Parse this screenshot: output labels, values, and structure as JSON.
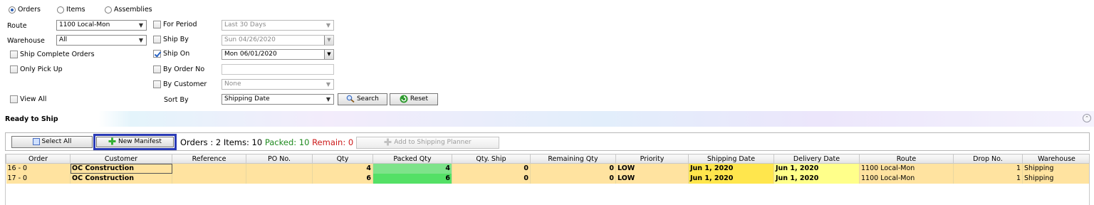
{
  "view_options": [
    {
      "label": "Orders",
      "selected": true
    },
    {
      "label": "Items",
      "selected": false
    },
    {
      "label": "Assemblies",
      "selected": false
    }
  ],
  "filters": {
    "route_label": "Route",
    "route_value": "1100 Local-Mon",
    "warehouse_label": "Warehouse",
    "warehouse_value": "All",
    "ship_complete_label": "Ship Complete Orders",
    "only_pickup_label": "Only Pick Up",
    "view_all_label": "View All",
    "for_period_label": "For Period",
    "for_period_value": "Last 30 Days",
    "ship_by_label": "Ship By",
    "ship_by_value": "Sun 04/26/2020",
    "ship_on_label": "Ship On",
    "ship_on_value": "Mon 06/01/2020",
    "ship_on_checked": true,
    "by_order_label": "By Order No",
    "by_order_value": "",
    "by_customer_label": "By Customer",
    "by_customer_value": "None",
    "sort_by_label": "Sort By",
    "sort_by_value": "Shipping Date",
    "search_label": "Search",
    "reset_label": "Reset"
  },
  "section_title": "Ready to Ship",
  "toolbar": {
    "select_all_label": "Select All",
    "new_manifest_label": "New Manifest",
    "summary_prefix": "Orders : 2 Items: 10 ",
    "packed_text": "Packed: 10",
    "remain_text": "Remain: 0",
    "add_planner_label": "Add to Shipping Planner"
  },
  "colors": {
    "packed": "#1f8a1f",
    "remain": "#cc1a1a",
    "row_bg": "#ffe3a0",
    "packed_cell": "#7ee38a",
    "ship_date_cell": "#ffe64d",
    "delivery_date_cell": "#ffff8a",
    "highlight_border": "#2a3bb5"
  },
  "table": {
    "columns": [
      "Order",
      "Customer",
      "Reference",
      "PO No.",
      "Qty",
      "Packed Qty",
      "Qty. Ship",
      "Remaining Qty",
      "Priority",
      "Shipping Date",
      "Delivery Date",
      "Route",
      "Drop No.",
      "Warehouse"
    ],
    "rows": [
      {
        "order": "16 - 0",
        "customer": "OC Construction",
        "reference": "",
        "po": "",
        "qty": "4",
        "packed": "4",
        "qty_ship": "0",
        "remaining": "0",
        "priority": "LOW",
        "ship_date": "Jun 1, 2020",
        "delivery_date": "Jun 1, 2020",
        "route": "1100 Local-Mon",
        "drop": "1",
        "warehouse": "Shipping"
      },
      {
        "order": "17 - 0",
        "customer": "OC Construction",
        "reference": "",
        "po": "",
        "qty": "6",
        "packed": "6",
        "qty_ship": "0",
        "remaining": "0",
        "priority": "LOW",
        "ship_date": "Jun 1, 2020",
        "delivery_date": "Jun 1, 2020",
        "route": "1100 Local-Mon",
        "drop": "1",
        "warehouse": "Shipping"
      }
    ]
  },
  "icons": {
    "collapse": "double-chevron-up-icon",
    "search": "magnifier-icon",
    "reset": "refresh-icon",
    "new_manifest": "plus-icon",
    "add_planner": "plus-icon",
    "select_all": "checkbox-icon"
  }
}
